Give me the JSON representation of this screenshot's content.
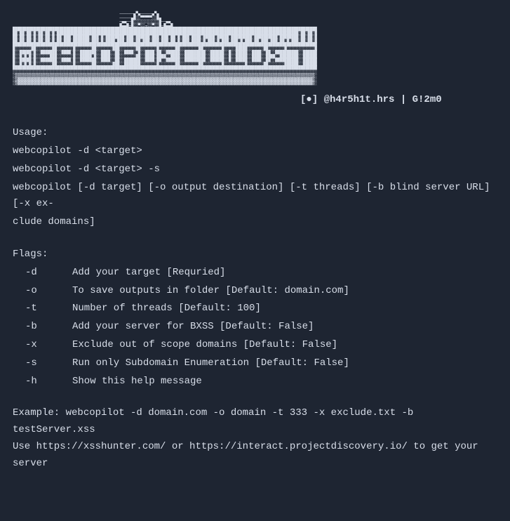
{
  "ascii_art": "                                              ──────▄▀▄─────▄▀▄\n                                              ─────▄█░░▀▀▀▀▀░░█▄\n                                              ─▄▄──█░░░░░░░░░░░█──▄▄\n                                              █▄▄█─█░░▀░░┬░░▀░░█─█▄▄█\n███████████████████████████████████████████████████████████████████████████████████████████████████████████████████████████████████\n██░██░██░█░██░██░█░████████████████████████████████████████████████████████████████████████████████████████████████████████░██░██░█\n██░██░██░█░██░██░█░██░███░███████░███░█░████████░███░██████░███░███░██░█░███░████░█████░█████░█████████░██████████░████████░██░██░█\n██░██░██░█░██░██░█░██░███░███████░███░█░████░███░███░██░███░███░███░██░█░███░████░█░███░█░███░███░█░███░██░███░███░██░█░███░██░██░█\n███████████████████████████████████████████████████████████████████████████████████████████████████████████████████████████████████\n█░░░░░░░██░░░░░░░██░░░░░░░█░░░░░░░██░░░░░░░███░░░░░░░██░░░░░░░█░░░░░░░██░░░░░░░░██░░░░░░░░█░░░░░█████░░░░░░░██░░░░░░░█░░░░░░░░░░░░█\n█░░█████░█░░███████░░████░█░░███████░░████░░██░░████░░█░░████░██░░██████░░█████████░░██████░░█░░█████░░████░░██░░██████████░░██████\n█░░█░█░█░█░░░░░░███░░░░░░░█░░█████░█░░████░░██░░░░░░░██░░████░████░░████░░█████████░░██████░░█░░█████░░████░░████░░████████░░██████\n█░░█████░█░░███████░░████░█░░███████░░████░░██░░███████░░████░██░░██████░░█████████░░██████░░█░░█████░░████░░██░░██████████░░██████\n█░░█░█░█░█░░░░░░░██░░░░░░░█░░░░░░░██░░░░░░░███░░███████░░░░░░░█░░░░░░░██░░░░░░░░██░░░░░░░░█░░░░░░░░░█░░░░░░░██░░░░░░░██████░░██████\n███████████████████████████████████████████████████████████████████████████████████████████████████████████████████████████████████\n░░░░░░░░░░░░░░░░░░░░░░░░░░░░░░░░░░░░░░░░░░░░░░░░░░░░░░░░░░░░░░░░░░░░░░░░░░░░░░░░░░░░░░░░░░░░░░░░░░░░░░░░░░░░░░░░░░░░░░░░░░░░░░░░░░░\n░▒▒▒▒▒▒▒▒▒▒▒▒▒▒▒▒▒▒▒▒▒▒▒▒▒▒▒▒▒▒▒▒▒▒▒▒▒▒▒▒▒▒▒▒▒▒▒▒▒▒▒▒▒▒▒▒▒▒▒▒▒▒▒▒▒▒▒▒▒▒▒▒▒▒▒▒▒▒▒▒▒▒▒▒▒▒▒▒▒▒▒▒▒▒▒▒▒▒▒▒▒▒▒▒▒▒▒▒▒▒▒▒▒▒▒▒▒▒▒▒▒▒▒▒▒▒▒▒▒░\n░▒▓▓▓▓▓▓▓▓▓▓▓▓▓▓▓▓▓▓▓▓▓▓▓▓▓▓▓▓▓▓▓▓▓▓▓▓▓▓▓▓▓▓▓▓▓▓▓▓▓▓▓▓▓▓▓▓▓▓▓▓▓▓▓▓▓▓▓▓▓▓▓▓▓▓▓▓▓▓▓▓▓▓▓▓▓▓▓▓▓▓▓▓▓▓▓▓▓▓▓▓▓▓▓▓▓▓▓▓▓▓▓▓▓▓▓▓▓▓▓▓▓▓▓▓▓▓▓▒░\n░▒▓▓▓▓▓▓▓▓▓▓▓▓▓▓▓▓▓▓▓▓▓▓▓▓▓▓▓▓▓▓▓▓▓▓▓▓▓▓▓▓▓▓▓▓▓▓▓▓▓▓▓▓▓▓▓▓▓▓▓▓▓▓▓▓▓▓▓▓▓▓▓▓▓▓▓▓▓▓▓▓▓▓▓▓▓▓▓▓▓▓▓▓▓▓▓▓▓▓▓▓▓▓▓▓▓▓▓▓▓▓▓▓▓▓▓▓▓▓▓▓▓▓▓▓▓▓▓▒░",
  "credit": "[●] @h4r5h1t.hrs | G!2m0",
  "usage": {
    "header": "Usage:",
    "lines": [
      "webcopilot -d <target>",
      "webcopilot -d <target> -s",
      "webcopilot [-d target] [-o output destination] [-t threads] [-b blind server URL] [-x ex-",
      "clude domains]"
    ]
  },
  "flags": {
    "header": "Flags:",
    "items": [
      {
        "name": "-d",
        "desc": "Add your target [Requried]"
      },
      {
        "name": "-o",
        "desc": "To save outputs in folder [Default: domain.com]"
      },
      {
        "name": "-t",
        "desc": "Number of threads [Default: 100]"
      },
      {
        "name": "-b",
        "desc": "Add your server for BXSS [Default: False]"
      },
      {
        "name": "-x",
        "desc": "Exclude out of scope domains [Default: False]"
      },
      {
        "name": "-s",
        "desc": "Run only Subdomain Enumeration [Default: False]"
      },
      {
        "name": "-h",
        "desc": "Show this help message"
      }
    ]
  },
  "example": {
    "line1": "Example: webcopilot  -d domain.com -o domain -t 333 -x exclude.txt -b testServer.xss",
    "line2": "Use https://xsshunter.com/ or https://interact.projectdiscovery.io/ to get your server"
  }
}
